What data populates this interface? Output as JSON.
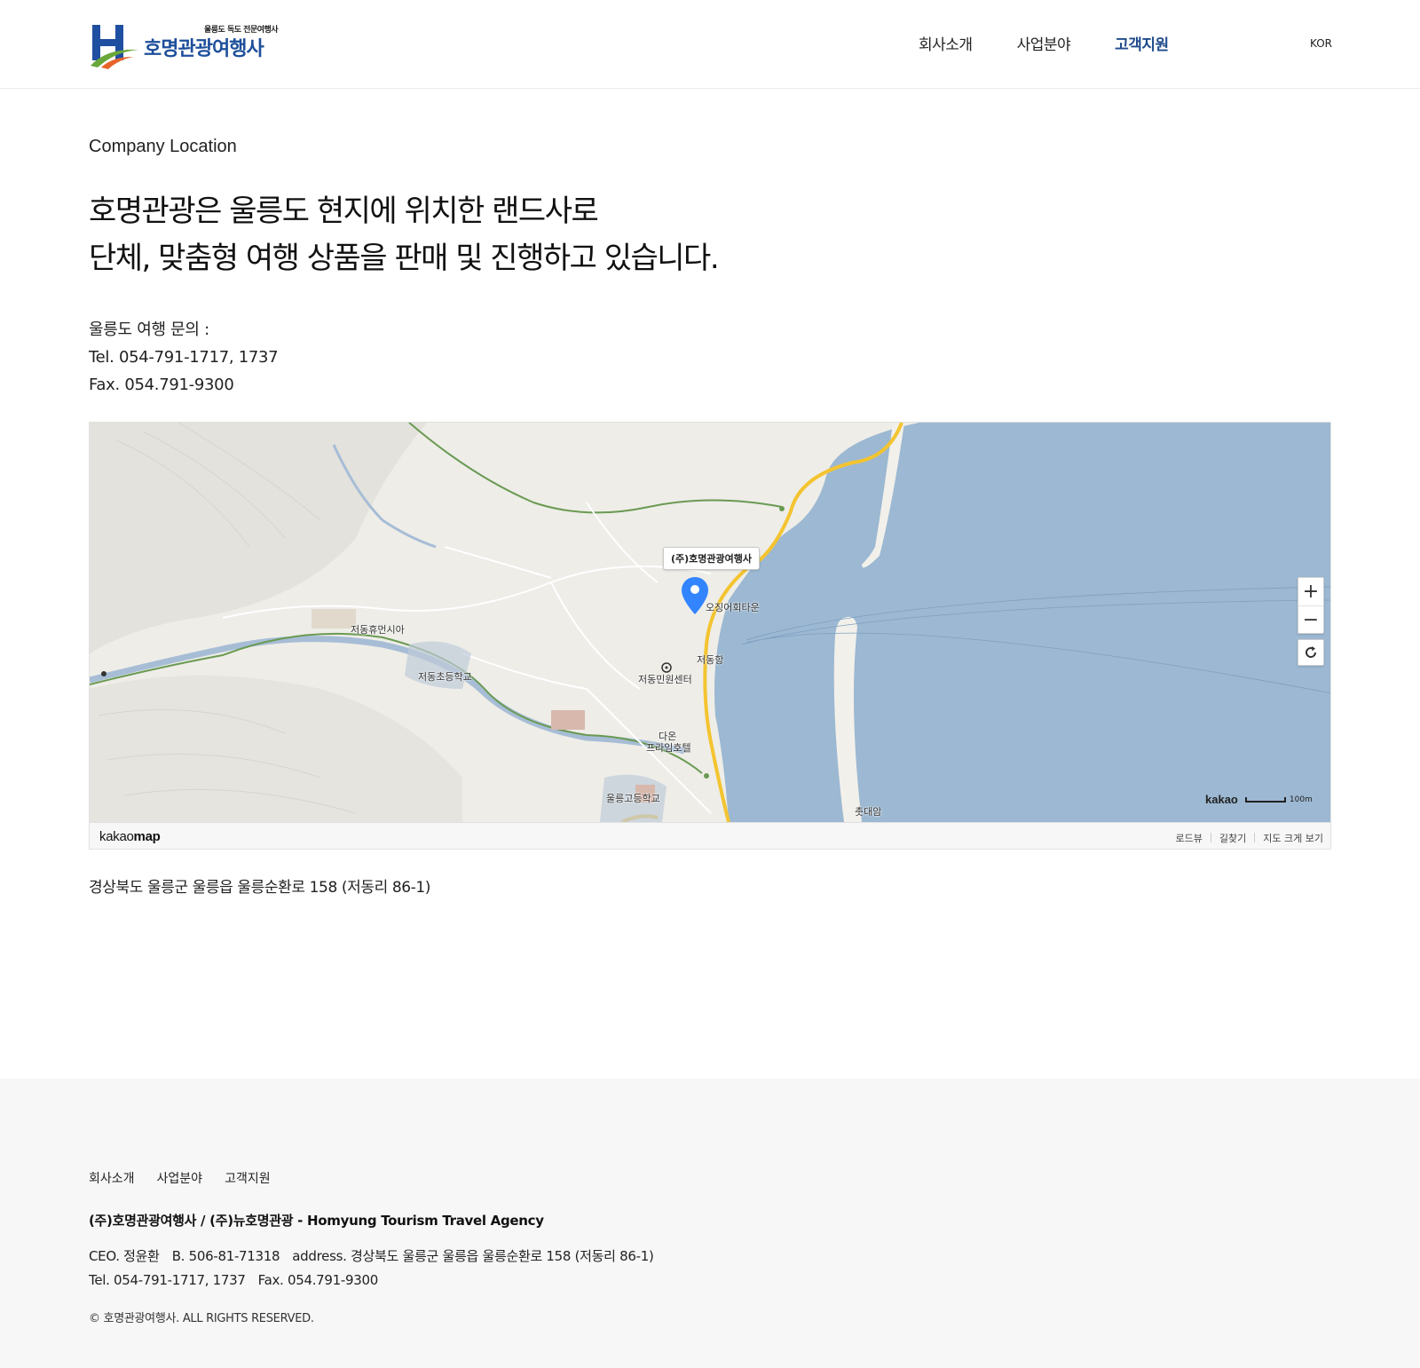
{
  "header": {
    "logo_tagline": "울릉도 독도 전문여행사",
    "logo_name": "호명관광여행사",
    "nav": [
      "회사소개",
      "사업분야",
      "고객지원"
    ],
    "active_nav": "고객지원",
    "language": "KOR",
    "brand_color": "#1f4a8c"
  },
  "main": {
    "eyebrow": "Company Location",
    "headline_line1": "호명관광은 울릉도 현지에 위치한 랜드사로",
    "headline_line2": "단체, 맞춤형 여행 상품을 판매 및 진행하고 있습니다.",
    "inquiry_label": "울릉도 여행 문의 :",
    "tel": "Tel. 054-791-1717, 1737",
    "fax": "Fax. 054.791-9300",
    "address": "경상북도 울릉군 울릉읍 울릉순환로 158 (저동리 86-1)"
  },
  "map": {
    "marker_label": "(주)호명관광여행사",
    "places": {
      "restaurant": "오징어회타운",
      "rest_area": "저동휴먼시아",
      "elementary_school": "저동초등학교",
      "civil_center": "저동민원센터",
      "port": "저동항",
      "hotel_line1": "다온",
      "hotel_line2": "프라임호텔",
      "high_school": "울릉고등학교",
      "rock": "촛대암"
    },
    "zoom_in": "+",
    "zoom_out": "−",
    "provider_logo_light": "kakao",
    "provider_logo_bold": "map",
    "scale_brand": "kakao",
    "scale_unit": "100m",
    "links": [
      "로드뷰",
      "길찾기",
      "지도 크게 보기"
    ],
    "sea_color": "#9cb8d2",
    "land_color": "#eeede8",
    "road_color": "#f4c430",
    "marker_color": "#3385ff"
  },
  "footer": {
    "nav": [
      "회사소개",
      "사업분야",
      "고객지원"
    ],
    "company": "(주)호명관광여행사 / (주)뉴호명관광 - Homyung Tourism Travel Agency",
    "ceo": "CEO. 정윤환",
    "biz_no": "B. 506-81-71318",
    "address": "address. 경상북도 울릉군 울릉읍 울릉순환로 158 (저동리 86-1)",
    "tel": "Tel. 054-791-1717, 1737",
    "fax": "Fax. 054.791-9300",
    "copyright": "© 호명관광여행사. ALL RIGHTS RESERVED."
  }
}
